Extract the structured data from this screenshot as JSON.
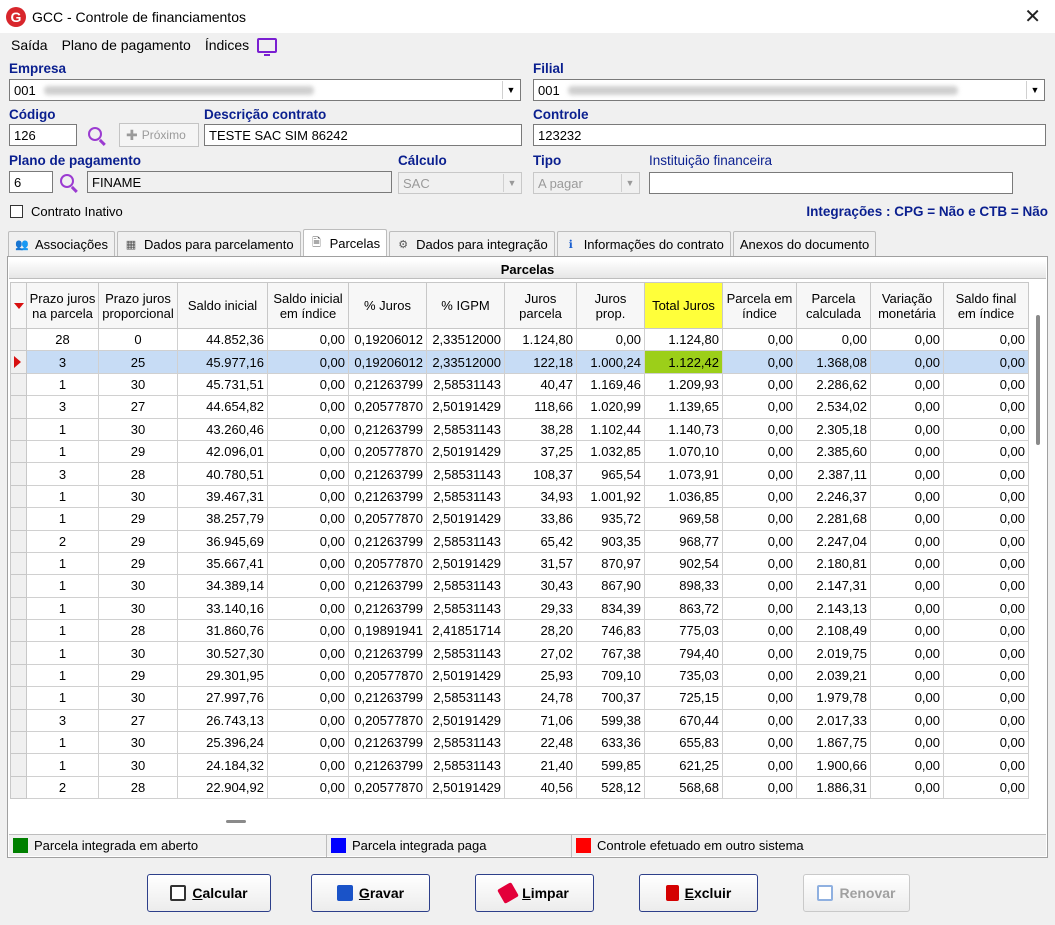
{
  "window": {
    "title": "GCC - Controle de financiamentos",
    "logo_letter": "G",
    "close_glyph": "✕"
  },
  "menu": {
    "items": [
      "Saída",
      "Plano de pagamento",
      "Índices"
    ]
  },
  "form": {
    "empresa_label": "Empresa",
    "empresa_value": "001",
    "filial_label": "Filial",
    "filial_value": "001",
    "codigo_label": "Código",
    "codigo_value": "126",
    "proximo_label": "Próximo",
    "descricao_label": "Descrição contrato",
    "descricao_value": "TESTE SAC SIM 86242",
    "controle_label": "Controle",
    "controle_value": "123232",
    "plano_label": "Plano de pagamento",
    "plano_code": "6",
    "plano_name": "FINAME",
    "calculo_label": "Cálculo",
    "calculo_value": "SAC",
    "tipo_label": "Tipo",
    "tipo_value": "A pagar",
    "instituicao_label": "Instituição financeira",
    "instituicao_value": "",
    "inativo_label": "Contrato Inativo",
    "integracoes_text": "Integrações : CPG = Não e CTB = Não"
  },
  "tabs": [
    {
      "label": "Associações",
      "icon": "users-icon"
    },
    {
      "label": "Dados para parcelamento",
      "icon": "calculator-icon"
    },
    {
      "label": "Parcelas",
      "icon": "document-icon",
      "active": true
    },
    {
      "label": "Dados para integração",
      "icon": "gear-icon"
    },
    {
      "label": "Informações do contrato",
      "icon": "info-icon"
    },
    {
      "label": "Anexos do documento",
      "icon": ""
    }
  ],
  "grid": {
    "title": "Parcelas",
    "columns": [
      "Prazo juros na parcela",
      "Prazo juros proporcional",
      "Saldo inicial",
      "Saldo inicial em índice",
      "% Juros",
      "% IGPM",
      "Juros parcela",
      "Juros prop.",
      "Total Juros",
      "Parcela em índice",
      "Parcela calculada",
      "Variação monetária",
      "Saldo final em índice"
    ],
    "rows": [
      [
        "28",
        "0",
        "44.852,36",
        "0,00",
        "0,19206012",
        "2,33512000",
        "1.124,80",
        "0,00",
        "1.124,80",
        "0,00",
        "0,00",
        "0,00",
        "0,00"
      ],
      [
        "3",
        "25",
        "45.977,16",
        "0,00",
        "0,19206012",
        "2,33512000",
        "122,18",
        "1.000,24",
        "1.122,42",
        "0,00",
        "1.368,08",
        "0,00",
        "0,00"
      ],
      [
        "1",
        "30",
        "45.731,51",
        "0,00",
        "0,21263799",
        "2,58531143",
        "40,47",
        "1.169,46",
        "1.209,93",
        "0,00",
        "2.286,62",
        "0,00",
        "0,00"
      ],
      [
        "3",
        "27",
        "44.654,82",
        "0,00",
        "0,20577870",
        "2,50191429",
        "118,66",
        "1.020,99",
        "1.139,65",
        "0,00",
        "2.534,02",
        "0,00",
        "0,00"
      ],
      [
        "1",
        "30",
        "43.260,46",
        "0,00",
        "0,21263799",
        "2,58531143",
        "38,28",
        "1.102,44",
        "1.140,73",
        "0,00",
        "2.305,18",
        "0,00",
        "0,00"
      ],
      [
        "1",
        "29",
        "42.096,01",
        "0,00",
        "0,20577870",
        "2,50191429",
        "37,25",
        "1.032,85",
        "1.070,10",
        "0,00",
        "2.385,60",
        "0,00",
        "0,00"
      ],
      [
        "3",
        "28",
        "40.780,51",
        "0,00",
        "0,21263799",
        "2,58531143",
        "108,37",
        "965,54",
        "1.073,91",
        "0,00",
        "2.387,11",
        "0,00",
        "0,00"
      ],
      [
        "1",
        "30",
        "39.467,31",
        "0,00",
        "0,21263799",
        "2,58531143",
        "34,93",
        "1.001,92",
        "1.036,85",
        "0,00",
        "2.246,37",
        "0,00",
        "0,00"
      ],
      [
        "1",
        "29",
        "38.257,79",
        "0,00",
        "0,20577870",
        "2,50191429",
        "33,86",
        "935,72",
        "969,58",
        "0,00",
        "2.281,68",
        "0,00",
        "0,00"
      ],
      [
        "2",
        "29",
        "36.945,69",
        "0,00",
        "0,21263799",
        "2,58531143",
        "65,42",
        "903,35",
        "968,77",
        "0,00",
        "2.247,04",
        "0,00",
        "0,00"
      ],
      [
        "1",
        "29",
        "35.667,41",
        "0,00",
        "0,20577870",
        "2,50191429",
        "31,57",
        "870,97",
        "902,54",
        "0,00",
        "2.180,81",
        "0,00",
        "0,00"
      ],
      [
        "1",
        "30",
        "34.389,14",
        "0,00",
        "0,21263799",
        "2,58531143",
        "30,43",
        "867,90",
        "898,33",
        "0,00",
        "2.147,31",
        "0,00",
        "0,00"
      ],
      [
        "1",
        "30",
        "33.140,16",
        "0,00",
        "0,21263799",
        "2,58531143",
        "29,33",
        "834,39",
        "863,72",
        "0,00",
        "2.143,13",
        "0,00",
        "0,00"
      ],
      [
        "1",
        "28",
        "31.860,76",
        "0,00",
        "0,19891941",
        "2,41851714",
        "28,20",
        "746,83",
        "775,03",
        "0,00",
        "2.108,49",
        "0,00",
        "0,00"
      ],
      [
        "1",
        "30",
        "30.527,30",
        "0,00",
        "0,21263799",
        "2,58531143",
        "27,02",
        "767,38",
        "794,40",
        "0,00",
        "2.019,75",
        "0,00",
        "0,00"
      ],
      [
        "1",
        "29",
        "29.301,95",
        "0,00",
        "0,20577870",
        "2,50191429",
        "25,93",
        "709,10",
        "735,03",
        "0,00",
        "2.039,21",
        "0,00",
        "0,00"
      ],
      [
        "1",
        "30",
        "27.997,76",
        "0,00",
        "0,21263799",
        "2,58531143",
        "24,78",
        "700,37",
        "725,15",
        "0,00",
        "1.979,78",
        "0,00",
        "0,00"
      ],
      [
        "3",
        "27",
        "26.743,13",
        "0,00",
        "0,20577870",
        "2,50191429",
        "71,06",
        "599,38",
        "670,44",
        "0,00",
        "2.017,33",
        "0,00",
        "0,00"
      ],
      [
        "1",
        "30",
        "25.396,24",
        "0,00",
        "0,21263799",
        "2,58531143",
        "22,48",
        "633,36",
        "655,83",
        "0,00",
        "1.867,75",
        "0,00",
        "0,00"
      ],
      [
        "1",
        "30",
        "24.184,32",
        "0,00",
        "0,21263799",
        "2,58531143",
        "21,40",
        "599,85",
        "621,25",
        "0,00",
        "1.900,66",
        "0,00",
        "0,00"
      ],
      [
        "2",
        "28",
        "22.904,92",
        "0,00",
        "0,20577870",
        "2,50191429",
        "40,56",
        "528,12",
        "568,68",
        "0,00",
        "1.886,31",
        "0,00",
        "0,00"
      ]
    ]
  },
  "legend": [
    {
      "label": "Parcela integrada em aberto",
      "color": "#008000"
    },
    {
      "label": "Parcela integrada paga",
      "color": "#0000ff"
    },
    {
      "label": "Controle efetuado em outro sistema",
      "color": "#ff0000"
    }
  ],
  "buttons": {
    "calcular": {
      "prefix": "C",
      "rest": "alcular"
    },
    "gravar": {
      "prefix": "G",
      "rest": "ravar"
    },
    "limpar": {
      "prefix": "L",
      "rest": "impar"
    },
    "excluir": {
      "prefix": "E",
      "rest": "xcluir"
    },
    "renovar": "Renovar"
  },
  "colors": {
    "accent": "#0a1f8f",
    "highlight_header": "#ffff3a",
    "highlight_cell": "#9ccf19",
    "selected_row": "#c7dcf5"
  }
}
